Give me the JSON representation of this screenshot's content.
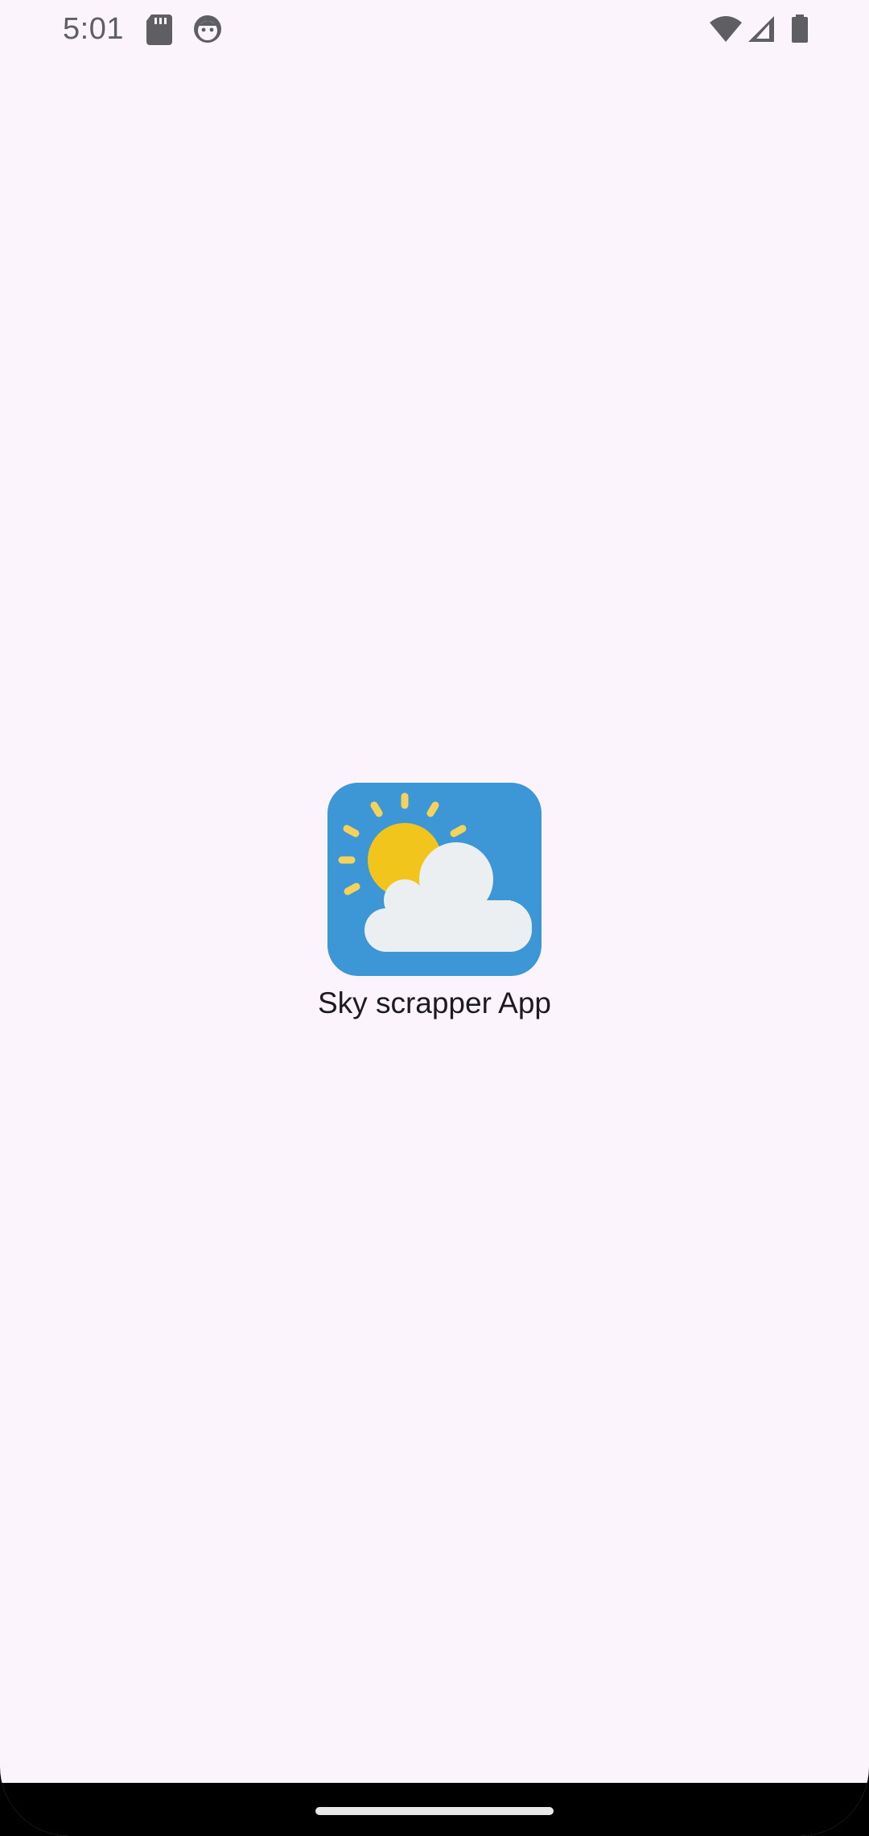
{
  "status_bar": {
    "time": "5:01",
    "icons": [
      "sd-card-icon",
      "face-icon",
      "wifi-icon",
      "signal-icon",
      "battery-icon"
    ]
  },
  "splash": {
    "app_name": "Sky scrapper App",
    "icon": "sun-cloud-icon",
    "icon_colors": {
      "background": "#3d97d6",
      "sun": "#f2c51c",
      "rays": "#f5d35a",
      "cloud": "#eceff1"
    }
  },
  "colors": {
    "screen_background": "#fcf4fc",
    "text": "#1d1b20",
    "status_text": "#5f5f63"
  }
}
